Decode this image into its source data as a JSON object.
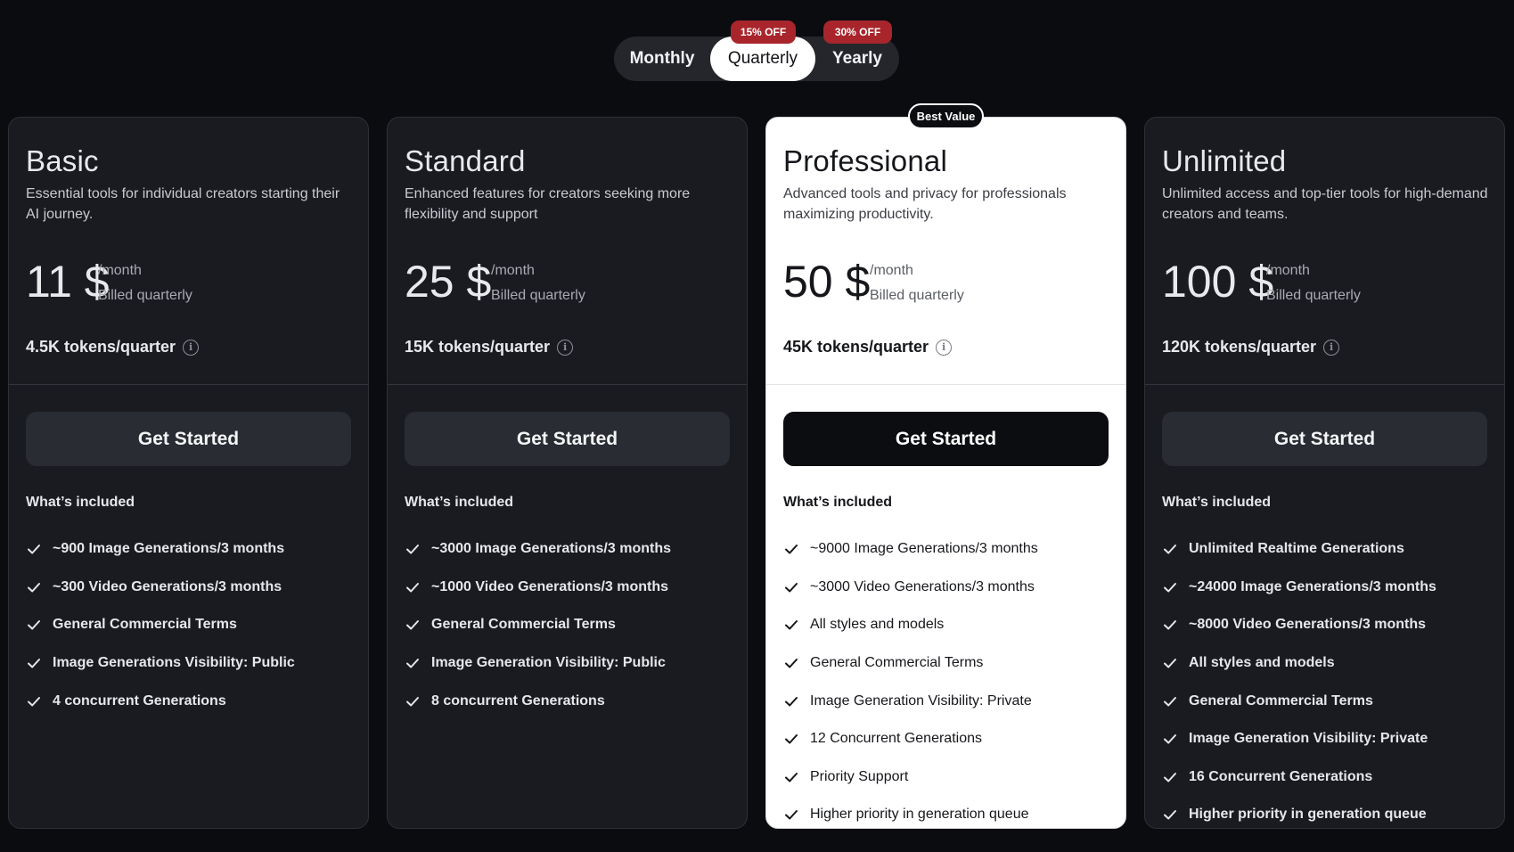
{
  "billing_toggle": {
    "options": [
      "Monthly",
      "Quarterly",
      "Yearly"
    ],
    "selected": "Quarterly",
    "quarterly_discount": "15% OFF",
    "yearly_discount": "30% OFF"
  },
  "badge": "Best Value",
  "plans": [
    {
      "name": "Basic",
      "description": "Essential tools for individual creators starting their AI journey.",
      "price": "11 $",
      "period": "/month",
      "billing": "Billed quarterly",
      "tokens": "4.5K tokens/quarter",
      "cta": "Get Started",
      "included_title": "What’s included",
      "features": [
        "~900 Image Generations/3 months",
        "~300 Video Generations/3 months",
        "General Commercial Terms",
        "Image Generations Visibility: Public",
        "4 concurrent Generations"
      ]
    },
    {
      "name": "Standard",
      "description": "Enhanced features for creators seeking more flexibility and support",
      "price": "25 $",
      "period": "/month",
      "billing": "Billed quarterly",
      "tokens": "15K tokens/quarter",
      "cta": "Get Started",
      "included_title": "What’s included",
      "features": [
        "~3000 Image Generations/3 months",
        "~1000 Video Generations/3 months",
        "General Commercial Terms",
        "Image Generation Visibility: Public",
        "8 concurrent Generations"
      ]
    },
    {
      "name": "Professional",
      "description": "Advanced tools and privacy for professionals maximizing productivity.",
      "price": "50 $",
      "period": "/month",
      "billing": "Billed quarterly",
      "tokens": "45K tokens/quarter",
      "cta": "Get Started",
      "included_title": "What’s included",
      "features": [
        "~9000 Image Generations/3 months",
        "~3000 Video Generations/3 months",
        "All styles and models",
        "General Commercial Terms",
        "Image Generation Visibility: Private",
        "12 Concurrent Generations",
        "Priority Support",
        "Higher priority in generation queue"
      ]
    },
    {
      "name": "Unlimited",
      "description": "Unlimited access and top-tier tools for high-demand creators and teams.",
      "price": "100 $",
      "period": "/month",
      "billing": "Billed quarterly",
      "tokens": "120K tokens/quarter",
      "cta": "Get Started",
      "included_title": "What’s included",
      "features": [
        "Unlimited Realtime Generations",
        "~24000 Image Generations/3 months",
        "~8000 Video Generations/3 months",
        "All styles and models",
        "General Commercial Terms",
        "Image Generation Visibility: Private",
        "16 Concurrent Generations",
        "Higher priority in generation queue"
      ]
    }
  ],
  "icons": {
    "info": "info-icon",
    "check": "check-icon"
  },
  "colors": {
    "discount_badge": "#a8252b",
    "highlight_card": "#ffffff",
    "page_bg": "#0b0c10"
  }
}
